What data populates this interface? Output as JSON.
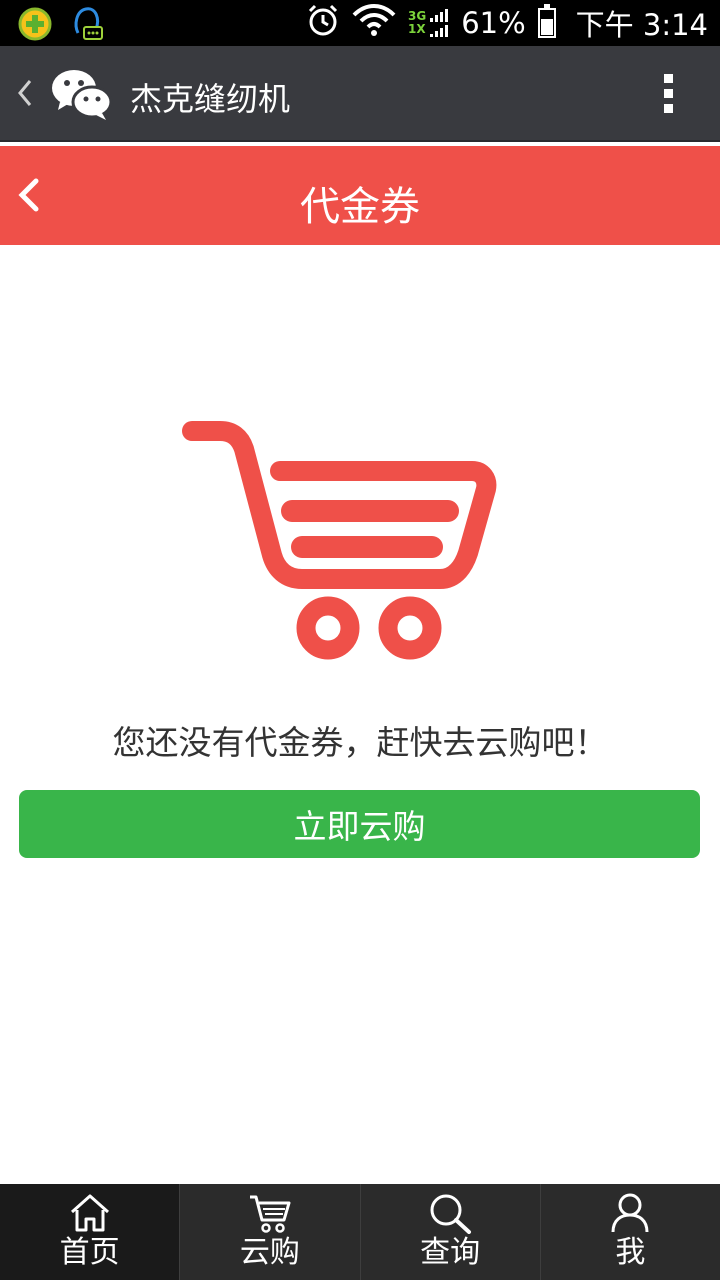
{
  "status_bar": {
    "net_top": "3G",
    "net_bottom": "1X",
    "battery": "61%",
    "battery_level": 0.61,
    "time": "下午 3:14",
    "icons": [
      "app-360-icon",
      "qq-notification-icon",
      "alarm-icon",
      "wifi-icon",
      "signal-icon",
      "battery-icon"
    ]
  },
  "wechat_bar": {
    "title": "杰克缝纫机",
    "icons": [
      "back-chevron-icon",
      "wechat-logo-icon",
      "more-vertical-icon"
    ]
  },
  "header": {
    "title": "代金券",
    "icons": [
      "back-arrow-icon"
    ]
  },
  "empty_state": {
    "icon": "shopping-cart-icon",
    "message": "您还没有代金券，赶快去云购吧！",
    "button_label": "立即云购"
  },
  "bottom_nav": {
    "items": [
      {
        "label": "首页",
        "icon": "home-icon",
        "active": true
      },
      {
        "label": "云购",
        "icon": "cart-icon",
        "active": false
      },
      {
        "label": "查询",
        "icon": "search-icon",
        "active": false
      },
      {
        "label": "我",
        "icon": "user-icon",
        "active": false
      }
    ]
  },
  "colors": {
    "status_bar_bg": "#000000",
    "wechat_bar_bg": "#393a3f",
    "header_red": "#ef5049",
    "cart_red": "#ef5049",
    "cta_green": "#39b54a",
    "bottom_nav_bg": "#2b2b2b"
  }
}
